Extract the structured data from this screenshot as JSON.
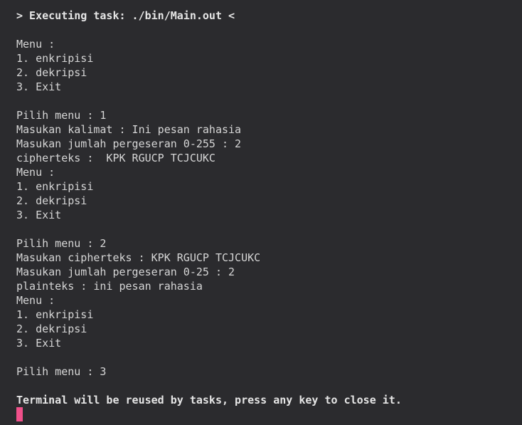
{
  "terminal": {
    "header": "> Executing task: ./bin/Main.out <",
    "menu1": {
      "title": "Menu :",
      "item1": "1. enkripisi",
      "item2": "2. dekripsi",
      "item3": "3. Exit"
    },
    "session1": {
      "choice": "Pilih menu : 1",
      "sentence": "Masukan kalimat : Ini pesan rahasia",
      "shift": "Masukan jumlah pergeseran 0-255 : 2",
      "result": "cipherteks :  KPK RGUCP TCJCUKC"
    },
    "menu2": {
      "title": "Menu :",
      "item1": "1. enkripisi",
      "item2": "2. dekripsi",
      "item3": "3. Exit"
    },
    "session2": {
      "choice": "Pilih menu : 2",
      "ciphertext": "Masukan cipherteks : KPK RGUCP TCJCUKC",
      "shift": "Masukan jumlah pergeseran 0-25 : 2",
      "result": "plainteks : ini pesan rahasia"
    },
    "menu3": {
      "title": "Menu :",
      "item1": "1. enkripisi",
      "item2": "2. dekripsi",
      "item3": "3. Exit"
    },
    "session3": {
      "choice": "Pilih menu : 3"
    },
    "footer": "Terminal will be reused by tasks, press any key to close it.",
    "cursor_color": "#f0508a",
    "background_color": "#2b2b2e"
  }
}
